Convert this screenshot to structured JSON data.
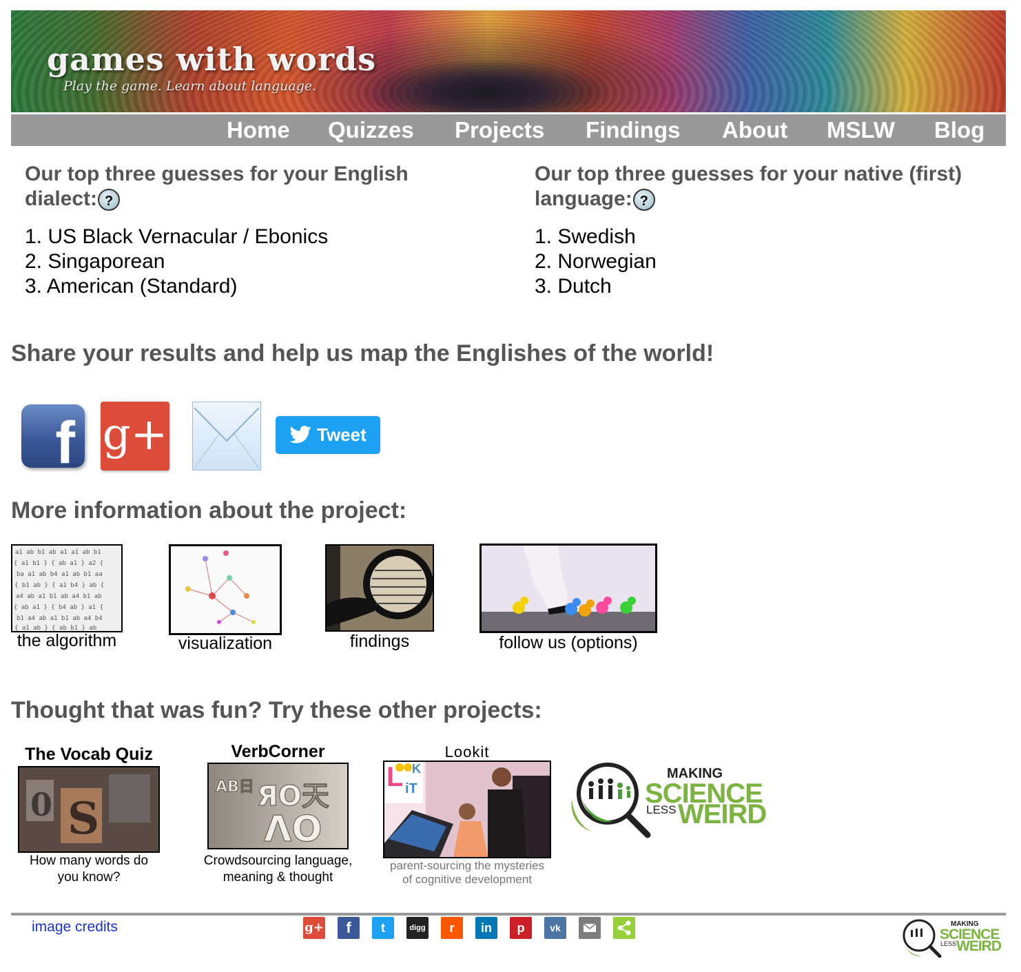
{
  "banner": {
    "title": "games with words",
    "tagline": "Play the game. Learn about language."
  },
  "nav": [
    "Home",
    "Quizzes",
    "Projects",
    "Findings",
    "About",
    "MSLW",
    "Blog"
  ],
  "dialect": {
    "heading_line1": "Our top three guesses for your English",
    "heading_line2": "dialect:",
    "help": "?",
    "items": [
      "1. US Black Vernacular / Ebonics",
      "2. Singaporean",
      "3. American (Standard)"
    ]
  },
  "native": {
    "heading_line1": "Our top three guesses for your native (first)",
    "heading_line2": "language:",
    "help": "?",
    "items": [
      "1. Swedish",
      "2. Norwegian",
      "3. Dutch"
    ]
  },
  "share": {
    "heading": "Share your results and help us map the Englishes of the world!",
    "facebook": "f",
    "googleplus": "g+",
    "tweet": "Tweet"
  },
  "more_info": {
    "heading": "More information about the project:",
    "items": [
      "the algorithm",
      "visualization",
      "findings",
      "follow us (options)"
    ]
  },
  "other_projects": {
    "heading": "Thought that was fun? Try these other projects:",
    "vocab": {
      "title": "The Vocab Quiz",
      "caption_line1": "How many words do",
      "caption_line2": "you know?"
    },
    "verbcorner": {
      "title": "VerbCorner",
      "caption_line1": "Crowdsourcing language,",
      "caption_line2": "meaning & thought"
    },
    "lookit": {
      "title": "Lookit",
      "caption_line1": "parent-sourcing the mysteries",
      "caption_line2": "of cognitive development",
      "logo_l": "L",
      "logo_k": "K",
      "logo_i": "iT"
    },
    "mslw": {
      "making": "MAKING",
      "science": "SCIENCE",
      "less": "LESS",
      "weird": "WEIRD"
    }
  },
  "footer": {
    "credits": "image credits",
    "social": [
      "g+",
      "f",
      "t",
      "digg",
      "r",
      "in",
      "p",
      "vk",
      "email",
      "share"
    ],
    "logo": {
      "making": "MAKING",
      "science": "SCIENCE",
      "less": "LESS",
      "weird": "WEIRD"
    }
  },
  "colors": {
    "nav_bg": "#999999",
    "heading": "#555555",
    "link": "#1a35c9",
    "mslw_green": "#7cb342"
  }
}
